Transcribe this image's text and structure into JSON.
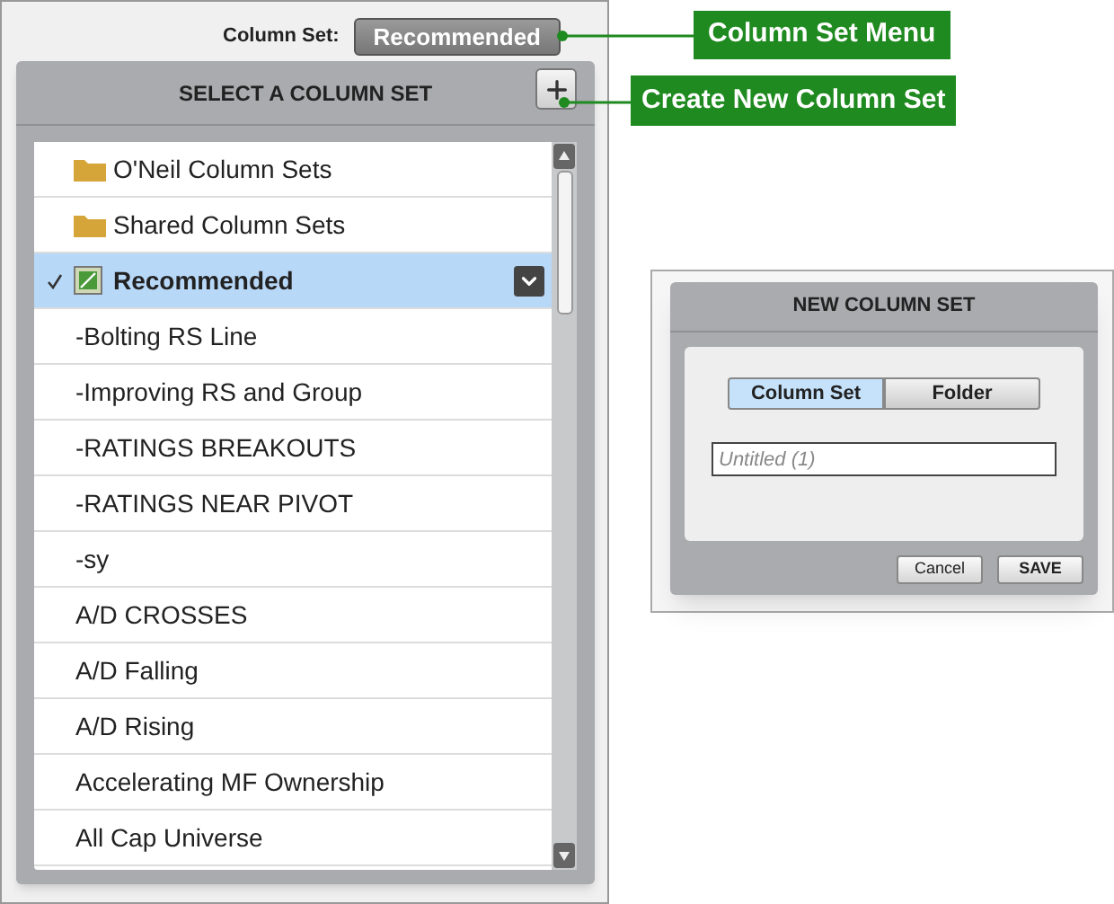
{
  "toolbar": {
    "label": "Column Set:",
    "menu_button": "Recommended"
  },
  "dropdown": {
    "title": "SELECT A COLUMN SET",
    "items": [
      {
        "kind": "folder",
        "label": "O'Neil Column Sets",
        "selected": false
      },
      {
        "kind": "folder",
        "label": "Shared Column Sets",
        "selected": false
      },
      {
        "kind": "set",
        "label": "Recommended",
        "selected": true
      },
      {
        "kind": "set",
        "label": "-Bolting RS Line",
        "selected": false
      },
      {
        "kind": "set",
        "label": "-Improving RS and Group",
        "selected": false
      },
      {
        "kind": "set",
        "label": "-RATINGS BREAKOUTS",
        "selected": false
      },
      {
        "kind": "set",
        "label": "-RATINGS NEAR PIVOT",
        "selected": false
      },
      {
        "kind": "set",
        "label": "-sy",
        "selected": false
      },
      {
        "kind": "set",
        "label": "A/D CROSSES",
        "selected": false
      },
      {
        "kind": "set",
        "label": "A/D Falling",
        "selected": false
      },
      {
        "kind": "set",
        "label": "A/D Rising",
        "selected": false
      },
      {
        "kind": "set",
        "label": "Accelerating MF Ownership",
        "selected": false
      },
      {
        "kind": "set",
        "label": "All Cap Universe",
        "selected": false
      }
    ]
  },
  "callouts": [
    "Column Set Menu",
    "Create New Column Set"
  ],
  "dialog": {
    "title": "NEW COLUMN SET",
    "toggle": [
      {
        "label": "Column Set",
        "selected": true
      },
      {
        "label": "Folder",
        "selected": false
      }
    ],
    "name_field": {
      "placeholder": "Untitled (1)"
    },
    "buttons": [
      "Cancel",
      "SAVE"
    ]
  }
}
